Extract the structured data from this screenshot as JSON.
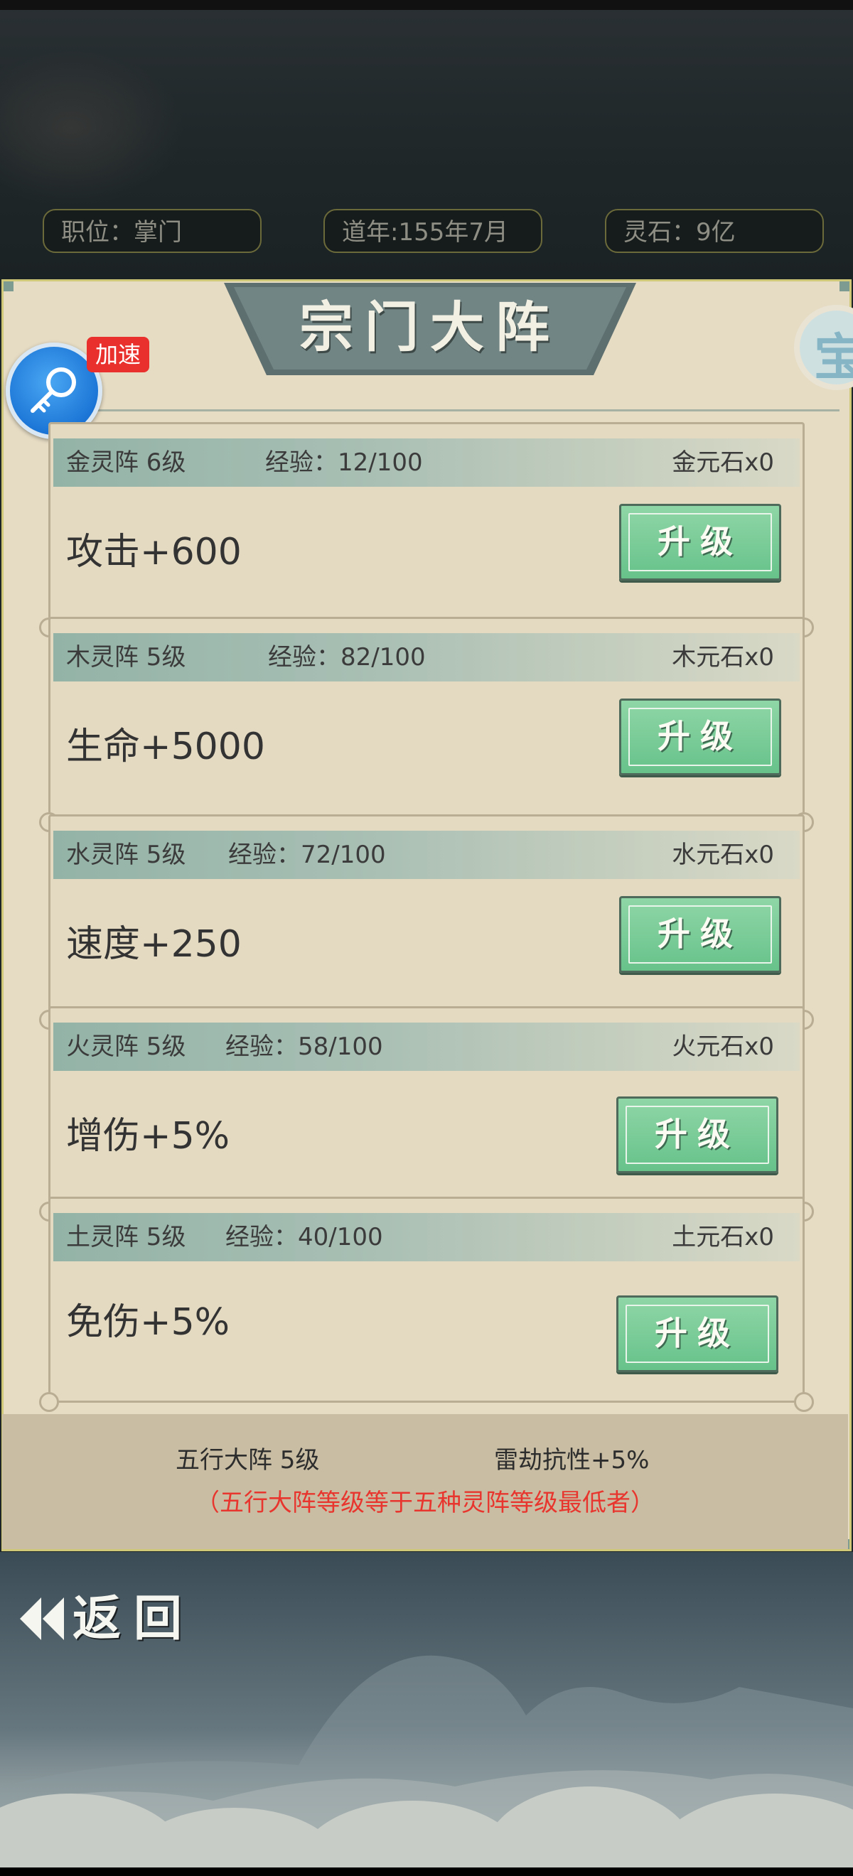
{
  "header": {
    "position": "职位：掌门",
    "year": "道年:155年7月",
    "spirit_stones": "灵石：9亿"
  },
  "panel": {
    "title": "宗门大阵",
    "side_icon_char": "宝"
  },
  "speed": {
    "badge": "加速"
  },
  "formations": [
    {
      "name": "金灵阵 6级",
      "exp": "经验：12/100",
      "stone": "金元石x0",
      "stat": "攻击+600",
      "button": "升级"
    },
    {
      "name": "木灵阵 5级",
      "exp": "经验：82/100",
      "stone": "木元石x0",
      "stat": "生命+5000",
      "button": "升级"
    },
    {
      "name": "水灵阵 5级",
      "exp": "经验：72/100",
      "stone": "水元石x0",
      "stat": "速度+250",
      "button": "升级"
    },
    {
      "name": "火灵阵 5级",
      "exp": "经验：58/100",
      "stone": "火元石x0",
      "stat": "增伤+5%",
      "button": "升级"
    },
    {
      "name": "土灵阵 5级",
      "exp": "经验：40/100",
      "stone": "土元石x0",
      "stat": "免伤+5%",
      "button": "升级"
    }
  ],
  "footer": {
    "grand_formation": "五行大阵 5级",
    "thunder_resist": "雷劫抗性+5%",
    "note": "（五行大阵等级等于五种灵阵等级最低者）"
  },
  "nav": {
    "back": "返回"
  },
  "colors": {
    "accent_green": "#67c28a",
    "panel_bg": "#e6dcc4",
    "badge_red": "#e9302d",
    "note_red": "#e8362e"
  }
}
